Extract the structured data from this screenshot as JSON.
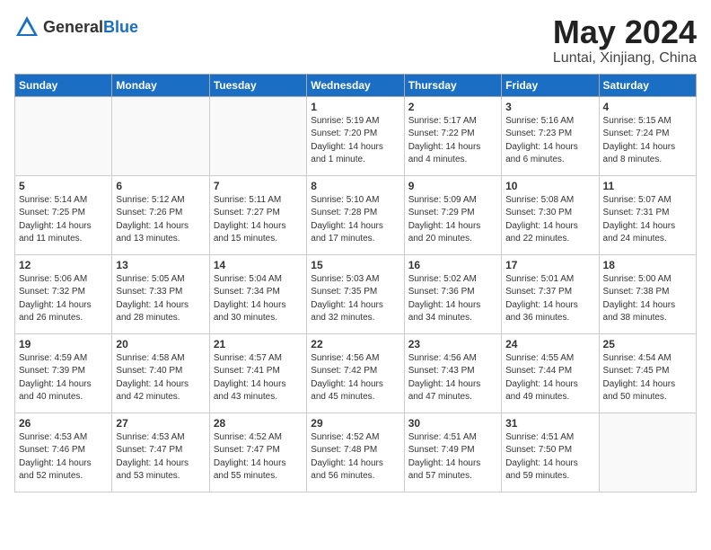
{
  "header": {
    "logo_general": "General",
    "logo_blue": "Blue",
    "month": "May 2024",
    "location": "Luntai, Xinjiang, China"
  },
  "days_of_week": [
    "Sunday",
    "Monday",
    "Tuesday",
    "Wednesday",
    "Thursday",
    "Friday",
    "Saturday"
  ],
  "weeks": [
    [
      {
        "day": "",
        "content": ""
      },
      {
        "day": "",
        "content": ""
      },
      {
        "day": "",
        "content": ""
      },
      {
        "day": "1",
        "content": "Sunrise: 5:19 AM\nSunset: 7:20 PM\nDaylight: 14 hours\nand 1 minute."
      },
      {
        "day": "2",
        "content": "Sunrise: 5:17 AM\nSunset: 7:22 PM\nDaylight: 14 hours\nand 4 minutes."
      },
      {
        "day": "3",
        "content": "Sunrise: 5:16 AM\nSunset: 7:23 PM\nDaylight: 14 hours\nand 6 minutes."
      },
      {
        "day": "4",
        "content": "Sunrise: 5:15 AM\nSunset: 7:24 PM\nDaylight: 14 hours\nand 8 minutes."
      }
    ],
    [
      {
        "day": "5",
        "content": "Sunrise: 5:14 AM\nSunset: 7:25 PM\nDaylight: 14 hours\nand 11 minutes."
      },
      {
        "day": "6",
        "content": "Sunrise: 5:12 AM\nSunset: 7:26 PM\nDaylight: 14 hours\nand 13 minutes."
      },
      {
        "day": "7",
        "content": "Sunrise: 5:11 AM\nSunset: 7:27 PM\nDaylight: 14 hours\nand 15 minutes."
      },
      {
        "day": "8",
        "content": "Sunrise: 5:10 AM\nSunset: 7:28 PM\nDaylight: 14 hours\nand 17 minutes."
      },
      {
        "day": "9",
        "content": "Sunrise: 5:09 AM\nSunset: 7:29 PM\nDaylight: 14 hours\nand 20 minutes."
      },
      {
        "day": "10",
        "content": "Sunrise: 5:08 AM\nSunset: 7:30 PM\nDaylight: 14 hours\nand 22 minutes."
      },
      {
        "day": "11",
        "content": "Sunrise: 5:07 AM\nSunset: 7:31 PM\nDaylight: 14 hours\nand 24 minutes."
      }
    ],
    [
      {
        "day": "12",
        "content": "Sunrise: 5:06 AM\nSunset: 7:32 PM\nDaylight: 14 hours\nand 26 minutes."
      },
      {
        "day": "13",
        "content": "Sunrise: 5:05 AM\nSunset: 7:33 PM\nDaylight: 14 hours\nand 28 minutes."
      },
      {
        "day": "14",
        "content": "Sunrise: 5:04 AM\nSunset: 7:34 PM\nDaylight: 14 hours\nand 30 minutes."
      },
      {
        "day": "15",
        "content": "Sunrise: 5:03 AM\nSunset: 7:35 PM\nDaylight: 14 hours\nand 32 minutes."
      },
      {
        "day": "16",
        "content": "Sunrise: 5:02 AM\nSunset: 7:36 PM\nDaylight: 14 hours\nand 34 minutes."
      },
      {
        "day": "17",
        "content": "Sunrise: 5:01 AM\nSunset: 7:37 PM\nDaylight: 14 hours\nand 36 minutes."
      },
      {
        "day": "18",
        "content": "Sunrise: 5:00 AM\nSunset: 7:38 PM\nDaylight: 14 hours\nand 38 minutes."
      }
    ],
    [
      {
        "day": "19",
        "content": "Sunrise: 4:59 AM\nSunset: 7:39 PM\nDaylight: 14 hours\nand 40 minutes."
      },
      {
        "day": "20",
        "content": "Sunrise: 4:58 AM\nSunset: 7:40 PM\nDaylight: 14 hours\nand 42 minutes."
      },
      {
        "day": "21",
        "content": "Sunrise: 4:57 AM\nSunset: 7:41 PM\nDaylight: 14 hours\nand 43 minutes."
      },
      {
        "day": "22",
        "content": "Sunrise: 4:56 AM\nSunset: 7:42 PM\nDaylight: 14 hours\nand 45 minutes."
      },
      {
        "day": "23",
        "content": "Sunrise: 4:56 AM\nSunset: 7:43 PM\nDaylight: 14 hours\nand 47 minutes."
      },
      {
        "day": "24",
        "content": "Sunrise: 4:55 AM\nSunset: 7:44 PM\nDaylight: 14 hours\nand 49 minutes."
      },
      {
        "day": "25",
        "content": "Sunrise: 4:54 AM\nSunset: 7:45 PM\nDaylight: 14 hours\nand 50 minutes."
      }
    ],
    [
      {
        "day": "26",
        "content": "Sunrise: 4:53 AM\nSunset: 7:46 PM\nDaylight: 14 hours\nand 52 minutes."
      },
      {
        "day": "27",
        "content": "Sunrise: 4:53 AM\nSunset: 7:47 PM\nDaylight: 14 hours\nand 53 minutes."
      },
      {
        "day": "28",
        "content": "Sunrise: 4:52 AM\nSunset: 7:47 PM\nDaylight: 14 hours\nand 55 minutes."
      },
      {
        "day": "29",
        "content": "Sunrise: 4:52 AM\nSunset: 7:48 PM\nDaylight: 14 hours\nand 56 minutes."
      },
      {
        "day": "30",
        "content": "Sunrise: 4:51 AM\nSunset: 7:49 PM\nDaylight: 14 hours\nand 57 minutes."
      },
      {
        "day": "31",
        "content": "Sunrise: 4:51 AM\nSunset: 7:50 PM\nDaylight: 14 hours\nand 59 minutes."
      },
      {
        "day": "",
        "content": ""
      }
    ]
  ]
}
